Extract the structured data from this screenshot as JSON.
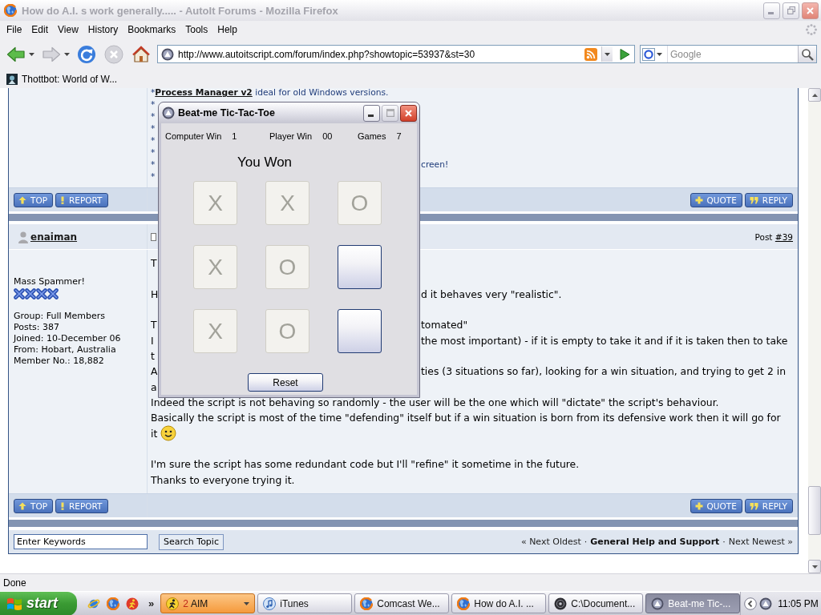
{
  "browser": {
    "title": "How do A.I. s work generally..... - AutoIt Forums - Mozilla Firefox",
    "active": false,
    "menu": [
      "File",
      "Edit",
      "View",
      "History",
      "Bookmarks",
      "Tools",
      "Help"
    ],
    "nav_buttons": [
      {
        "kind": "back",
        "disabled": false,
        "dropdown": true
      },
      {
        "kind": "forward",
        "disabled": true,
        "dropdown": true
      },
      {
        "kind": "reload",
        "disabled": false,
        "dropdown": false
      },
      {
        "kind": "stop",
        "disabled": true,
        "dropdown": false
      },
      {
        "kind": "home",
        "disabled": false,
        "dropdown": false
      }
    ],
    "address": "http://www.autoitscript.com/forum/index.php?showtopic=53937&st=30",
    "search_placeholder": "Google",
    "bookmarks": [
      "Thottbot: World of W..."
    ],
    "status": "Done"
  },
  "forum": {
    "previous_post": {
      "signature_lines": [
        {
          "bullet": "*",
          "link": "Process Manager v2",
          "text": "ideal for old Windows versions."
        },
        {
          "bullet": "*"
        },
        {
          "bullet": "*"
        },
        {
          "bullet": "*"
        },
        {
          "bullet": "*"
        },
        {
          "bullet": "*"
        },
        {
          "bullet": "*",
          "tail": "creen!"
        },
        {
          "bullet": "*"
        }
      ],
      "left_buttons": [
        {
          "kind": "top",
          "label": "TOP"
        },
        {
          "kind": "report",
          "label": "REPORT"
        }
      ],
      "right_buttons": [
        {
          "kind": "quote",
          "label": "QUOTE"
        },
        {
          "kind": "reply",
          "label": "REPLY"
        }
      ]
    },
    "post": {
      "author": "enaiman",
      "post_label": "Post",
      "post_link": "#39",
      "rank": "Mass Spammer!",
      "stars": 4,
      "details": [
        "Group: Full Members",
        "Posts: 387",
        "Joined: 10-December 06",
        "From: Hobart, Australia",
        "Member No.: 18,882"
      ],
      "paragraphs": [
        {
          "lines": [
            {
              "left": "T"
            }
          ]
        },
        {
          "lines": [
            {
              "left": "H",
              "right": "d it behaves very \"realistic\"."
            }
          ]
        },
        {
          "lines": [
            {
              "left": "T",
              "right": "tomated\""
            },
            {
              "left": "I",
              "right": "the most important) - if it is empty to take it and if it is taken then to take"
            },
            {
              "left": "t"
            },
            {
              "left": "A",
              "right": "ties (3 situations so far), looking for a win situation, and trying to get 2 in"
            },
            {
              "left": "a"
            },
            {
              "text": "Indeed the script is not behaving so randomly - the user will be the one which will \"dictate\" the script's behaviour."
            },
            {
              "text": "Basically the script is most of the time \"defending\" itself but if a win situation is born from its defensive work then it will go for"
            },
            {
              "text": "it",
              "emoticon": true
            }
          ]
        },
        {
          "lines": [
            {
              "text": "I'm sure the script has some redundant code but I'll \"refine\" it sometime in the future."
            },
            {
              "text": "Thanks to everyone trying it."
            }
          ]
        }
      ],
      "left_buttons": [
        {
          "kind": "top",
          "label": "TOP"
        },
        {
          "kind": "report",
          "label": "REPORT"
        }
      ],
      "right_buttons": [
        {
          "kind": "quote",
          "label": "QUOTE"
        },
        {
          "kind": "reply",
          "label": "REPLY"
        }
      ]
    },
    "search": {
      "value": "Enter Keywords",
      "button": "Search Topic"
    },
    "topic_nav": [
      {
        "kind": "link",
        "text": "« Next Oldest"
      },
      {
        "kind": "separator",
        "text": "·"
      },
      {
        "kind": "forum",
        "text": "General Help and Support"
      },
      {
        "kind": "separator",
        "text": "·"
      },
      {
        "kind": "link",
        "text": "Next Newest »"
      }
    ]
  },
  "game_window": {
    "title": "Beat-me Tic-Tac-Toe",
    "active": true,
    "caption_buttons": [
      {
        "kind": "minimize",
        "disabled": false
      },
      {
        "kind": "maximize",
        "disabled": true
      },
      {
        "kind": "close",
        "disabled": false
      }
    ],
    "scores": [
      {
        "label": "Computer Win",
        "value": "1"
      },
      {
        "label": "Player Win",
        "value": "00"
      },
      {
        "label": "Games",
        "value": "7"
      }
    ],
    "result": "You Won",
    "board": [
      {
        "mark": "X",
        "disabled": true
      },
      {
        "mark": "X",
        "disabled": true
      },
      {
        "mark": "O",
        "disabled": true
      },
      {
        "mark": "X",
        "disabled": true
      },
      {
        "mark": "O",
        "disabled": true
      },
      {
        "disabled": false
      },
      {
        "mark": "X",
        "disabled": true
      },
      {
        "mark": "O",
        "disabled": true
      },
      {
        "disabled": false
      }
    ],
    "reset": "Reset"
  },
  "taskbar": {
    "start": "start",
    "quick_launch_more": "»",
    "tasks": [
      {
        "kind": "messenger",
        "count": "2",
        "label": "AIM",
        "grouped": true,
        "flashing": true,
        "selected": false
      },
      {
        "kind": "music",
        "label": "iTunes",
        "grouped": false,
        "flashing": false,
        "selected": false
      },
      {
        "kind": "browser",
        "label": "Comcast We...",
        "grouped": false,
        "flashing": false,
        "selected": false
      },
      {
        "kind": "browser",
        "label": "How do A.I. ...",
        "grouped": false,
        "flashing": false,
        "selected": false
      },
      {
        "kind": "disc",
        "label": "C:\\Document...",
        "grouped": false,
        "flashing": false,
        "selected": false
      },
      {
        "kind": "app",
        "label": "Beat-me Tic-...",
        "grouped": false,
        "flashing": false,
        "selected": true
      }
    ],
    "clock": "11:05 PM"
  }
}
